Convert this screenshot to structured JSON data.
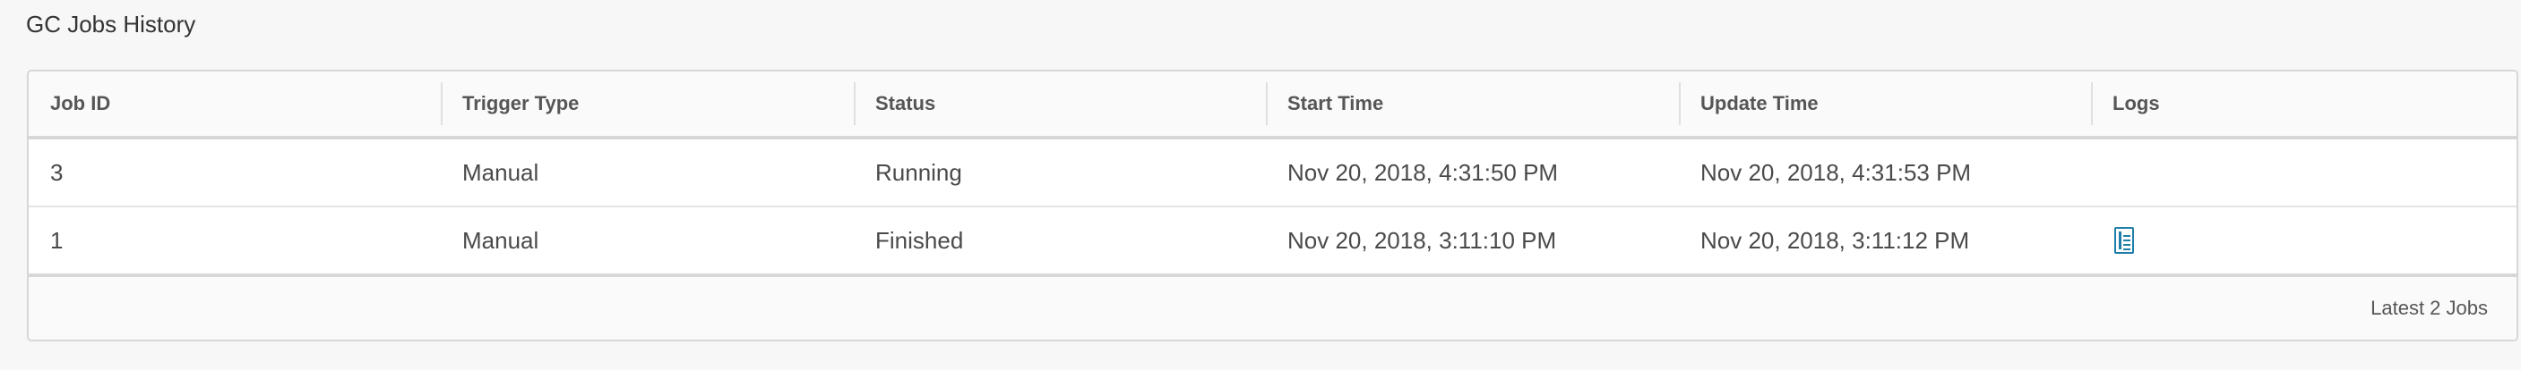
{
  "page": {
    "title": "GC Jobs History"
  },
  "table": {
    "columns": [
      "Job ID",
      "Trigger Type",
      "Status",
      "Start Time",
      "Update Time",
      "Logs"
    ],
    "rows": [
      {
        "job_id": "3",
        "trigger_type": "Manual",
        "status": "Running",
        "start_time": "Nov 20, 2018, 4:31:50 PM",
        "update_time": "Nov 20, 2018, 4:31:53 PM",
        "has_log": false
      },
      {
        "job_id": "1",
        "trigger_type": "Manual",
        "status": "Finished",
        "start_time": "Nov 20, 2018, 3:11:10 PM",
        "update_time": "Nov 20, 2018, 3:11:12 PM",
        "has_log": true,
        "log_icon": "document-icon"
      }
    ],
    "footer": "Latest 2 Jobs"
  },
  "colors": {
    "accent": "#1f7ea8",
    "border": "#d7d7d7",
    "background": "#f7f7f7"
  }
}
